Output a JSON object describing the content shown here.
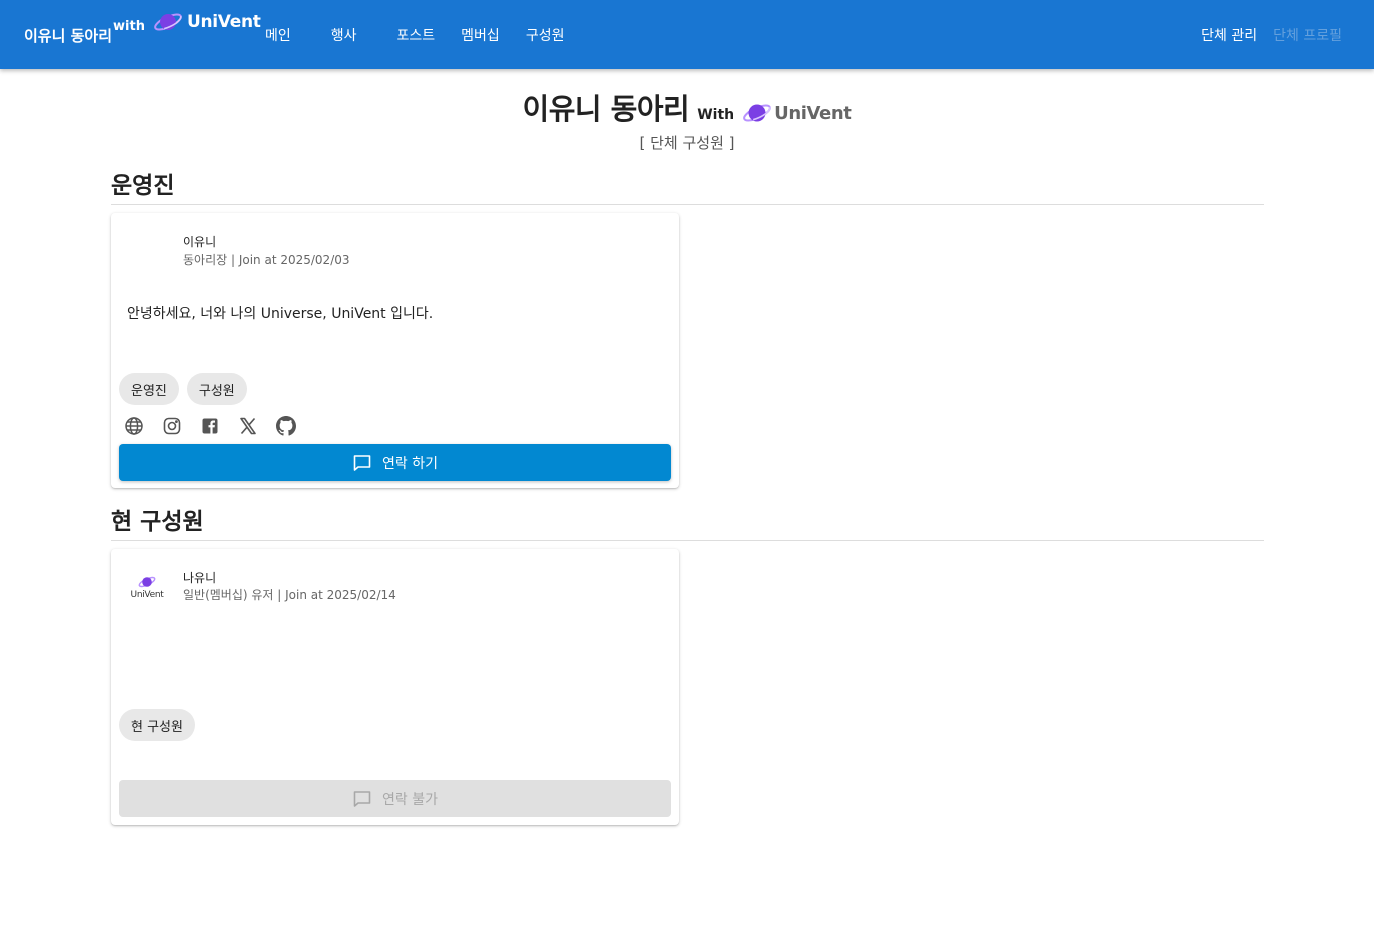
{
  "header": {
    "brand_name": "이유니 동아리",
    "brand_with": "with",
    "brand_logo_text": "UniVent",
    "nav": [
      "메인",
      "행사",
      "포스트",
      "멤버십",
      "구성원"
    ],
    "right": {
      "manage": "단체 관리",
      "profile": "단체 프로필"
    }
  },
  "page": {
    "title": "이유니 동아리",
    "title_with": "With",
    "title_logo_text": "UniVent",
    "subtitle": "[ 단체 구성원 ]"
  },
  "sections": [
    {
      "title": "운영진",
      "members": [
        {
          "name": "이유니",
          "meta": "동아리장 | Join at 2025/02/03",
          "bio": "안녕하세요, 너와 나의 Universe, UniVent 입니다.",
          "chips": [
            "운영진",
            "구성원"
          ],
          "socials": [
            "globe-icon",
            "instagram-icon",
            "facebook-icon",
            "x-icon",
            "github-icon"
          ],
          "button_label": "연락 하기"
        }
      ]
    },
    {
      "title": "현 구성원",
      "members": [
        {
          "name": "나유니",
          "meta": "일반(멤버십) 유저 | Join at 2025/02/14",
          "avatar_text": "UniVent",
          "chips": [
            "현 구성원"
          ],
          "button_label": "연락 불가"
        }
      ]
    }
  ],
  "colors": {
    "appbar": "#1976d2",
    "primary_button": "#0288d1",
    "disabled_button": "#e0e0e0",
    "logo_purple": "#7b3fe4"
  }
}
